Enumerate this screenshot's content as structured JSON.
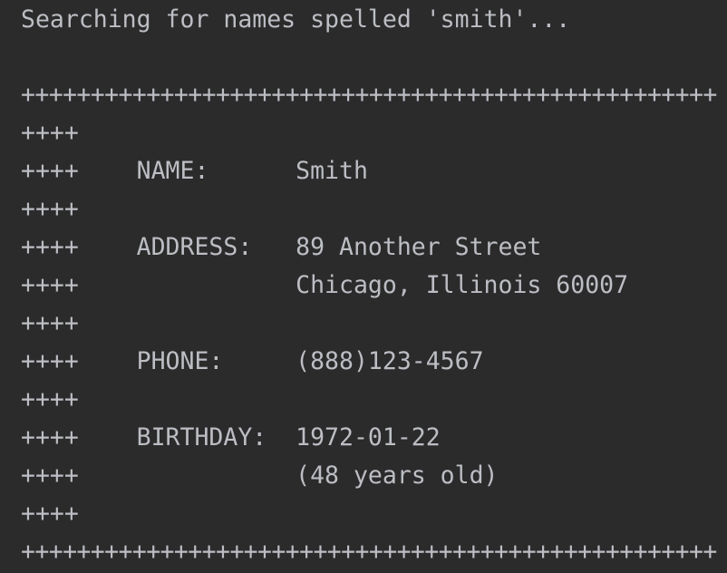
{
  "header": "Searching for names spelled 'smith'...",
  "border_line": "++++++++++++++++++++++++++++++++++++++++++++++++++",
  "rows": [
    "++++",
    "++++    NAME:      Smith",
    "++++",
    "++++    ADDRESS:   89 Another Street",
    "++++               Chicago, Illinois 60007",
    "++++",
    "++++    PHONE:     (888)123-4567",
    "++++",
    "++++    BIRTHDAY:  1972-01-22",
    "++++               (48 years old)",
    "++++"
  ],
  "colors": {
    "background": "#2b2b2b",
    "text": "#bcbec4"
  }
}
